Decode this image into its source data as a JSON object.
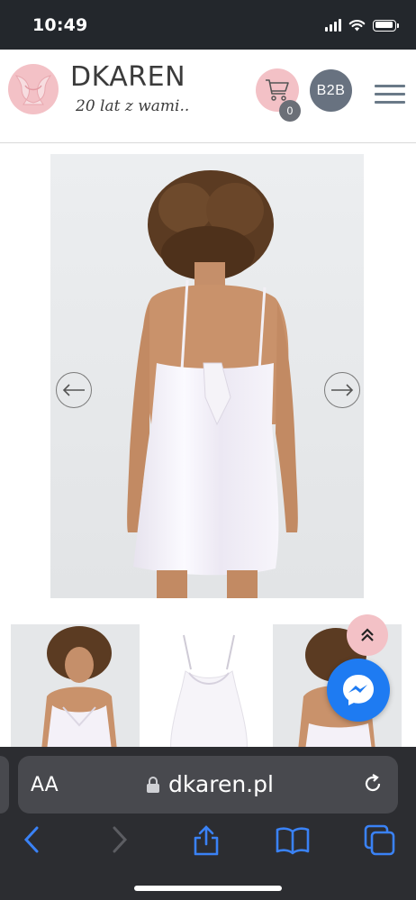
{
  "status_bar": {
    "time": "10:49"
  },
  "header": {
    "brand_name": "DKAREN",
    "tagline": "20 lat z wami..",
    "cart_count": "0",
    "b2b_label": "B2B",
    "logo_icon": "lingerie-logo-icon",
    "cart_icon": "cart-icon",
    "menu_icon": "hamburger-menu-icon",
    "accent_pink": "#f3c1c6",
    "badge_gray": "#6b6f77"
  },
  "gallery": {
    "prev_icon": "arrow-left-icon",
    "next_icon": "arrow-right-icon"
  },
  "floating": {
    "scroll_top_icon": "double-chevron-up-icon",
    "messenger_icon": "messenger-icon",
    "messenger_color": "#1e7bf2"
  },
  "browser": {
    "aa_label": "AA",
    "url": "dkaren.pl",
    "lock_icon": "lock-icon",
    "reload_icon": "reload-icon",
    "back_icon": "back-chevron-icon",
    "forward_icon": "forward-chevron-icon",
    "share_icon": "share-icon",
    "bookmarks_icon": "book-icon",
    "tabs_icon": "tabs-icon",
    "accent_blue": "#3a82f6"
  }
}
